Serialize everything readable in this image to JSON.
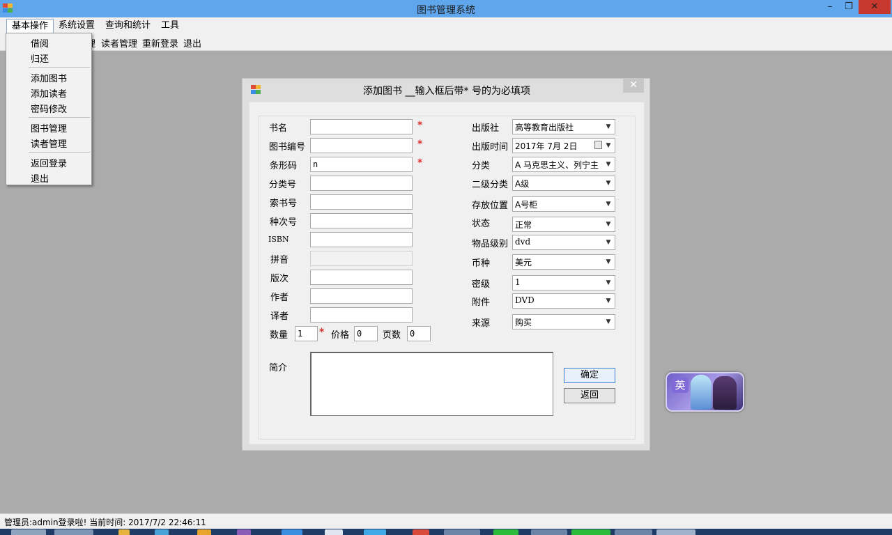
{
  "window": {
    "title": "图书管理系统",
    "minimize": "–",
    "maximize": "❐",
    "close": "✕"
  },
  "menubar": {
    "items": [
      "基本操作",
      "系统设置",
      "查询和统计",
      "工具"
    ]
  },
  "toolbar": {
    "items": [
      "理",
      "读者管理",
      "重新登录",
      "退出"
    ]
  },
  "dropdown": {
    "items": [
      "借阅",
      "归还",
      "添加图书",
      "添加读者",
      "密码修改",
      "图书管理",
      "读者管理",
      "返回登录",
      "退出"
    ]
  },
  "dialog": {
    "title": "添加图书 __输入框后带* 号的为必填项",
    "close": "✕",
    "required_mark": "*",
    "left_fields": {
      "book_name": {
        "label": "书名",
        "value": ""
      },
      "book_number": {
        "label": "图书编号",
        "value": ""
      },
      "barcode": {
        "label": "条形码",
        "value": "n"
      },
      "class_number": {
        "label": "分类号",
        "value": ""
      },
      "call_number": {
        "label": "索书号",
        "value": ""
      },
      "copy_number": {
        "label": "种次号",
        "value": ""
      },
      "isbn": {
        "label": "ISBN",
        "value": ""
      },
      "pinyin": {
        "label": "拼音",
        "value": ""
      },
      "edition": {
        "label": "版次",
        "value": ""
      },
      "author": {
        "label": "作者",
        "value": ""
      },
      "translator": {
        "label": "译者",
        "value": ""
      }
    },
    "quantity": {
      "label": "数量",
      "value": "1"
    },
    "price": {
      "label": "价格",
      "value": "0"
    },
    "pages": {
      "label": "页数",
      "value": "0"
    },
    "right_fields": {
      "publisher": {
        "label": "出版社",
        "value": "高等教育出版社"
      },
      "publish_date": {
        "label": "出版时间",
        "value": "2017年 7月 2日"
      },
      "category": {
        "label": "分类",
        "value": "A  马克思主义、列宁主"
      },
      "subcategory": {
        "label": "二级分类",
        "value": "A级"
      },
      "location": {
        "label": "存放位置",
        "value": "A号柜"
      },
      "status": {
        "label": "状态",
        "value": "正常"
      },
      "item_level": {
        "label": "物品级别",
        "value": "dvd"
      },
      "currency": {
        "label": "币种",
        "value": "美元"
      },
      "secret_level": {
        "label": "密级",
        "value": "1"
      },
      "attachment": {
        "label": "附件",
        "value": "DVD"
      },
      "source": {
        "label": "来源",
        "value": "购买"
      }
    },
    "summary": {
      "label": "简介",
      "value": ""
    },
    "buttons": {
      "ok": "确定",
      "back": "返回"
    }
  },
  "ime_widget": {
    "badge": "英"
  },
  "statusbar": {
    "text": "管理员:admin登录啦!  当前时间:  2017/7/2 22:46:11"
  },
  "colors": {
    "titlebar": "#5fa6ec",
    "close_button": "#c7382f",
    "desktop": "#ababab",
    "required": "#d9302e"
  }
}
